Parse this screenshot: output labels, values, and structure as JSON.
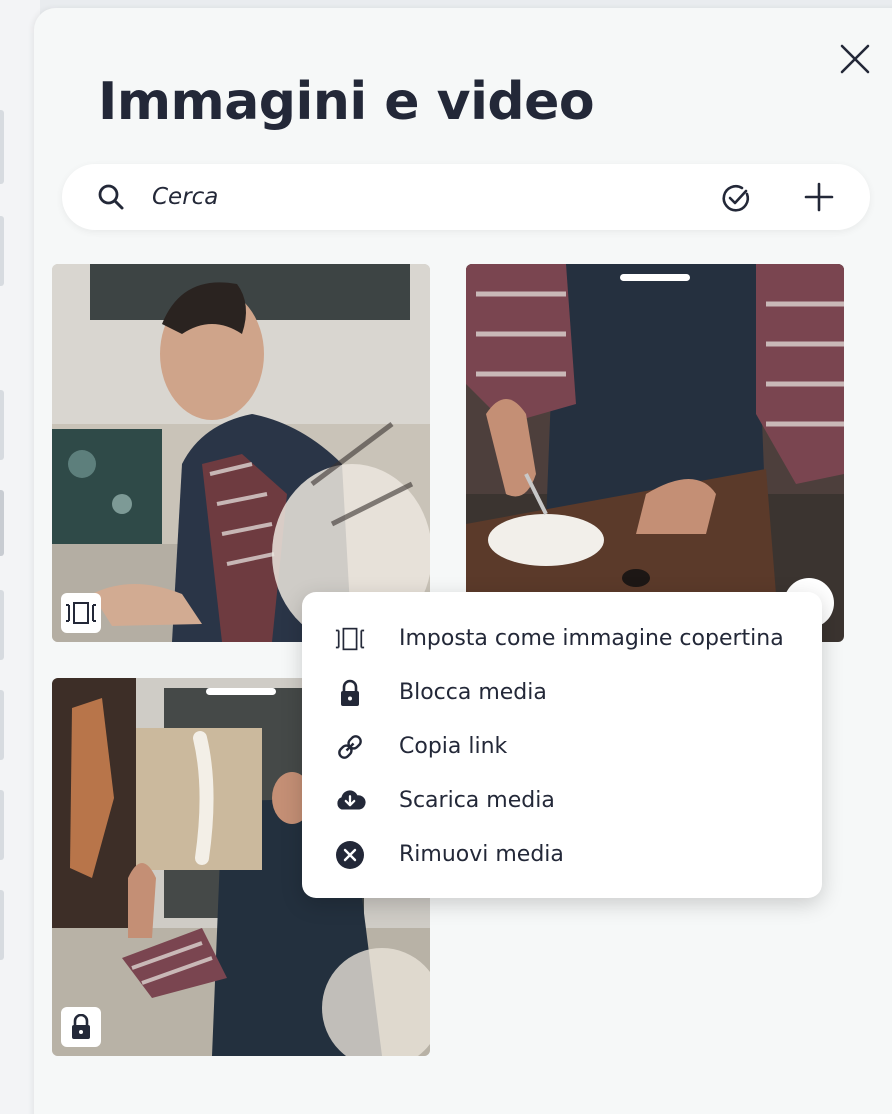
{
  "panel": {
    "title": "Immagini e video",
    "close_icon": "close-icon"
  },
  "search": {
    "placeholder": "Cerca",
    "search_icon": "search-icon",
    "select_icon": "check-circle-icon",
    "add_icon": "plus-icon"
  },
  "media": [
    {
      "badge_icon": "cover-image-icon"
    },
    {
      "badge_icon": "more-icon"
    },
    {
      "badge_icon": "lock-icon"
    }
  ],
  "context_menu": {
    "items": [
      {
        "label": "Imposta come immagine copertina",
        "icon": "cover-image-icon"
      },
      {
        "label": "Blocca media",
        "icon": "lock-icon"
      },
      {
        "label": "Copia link",
        "icon": "link-icon"
      },
      {
        "label": "Scarica media",
        "icon": "cloud-download-icon"
      },
      {
        "label": "Rimuovi media",
        "icon": "remove-circle-icon"
      }
    ]
  },
  "colors": {
    "text": "#232838",
    "panel_bg": "#f6f8f8",
    "surface": "#ffffff"
  }
}
